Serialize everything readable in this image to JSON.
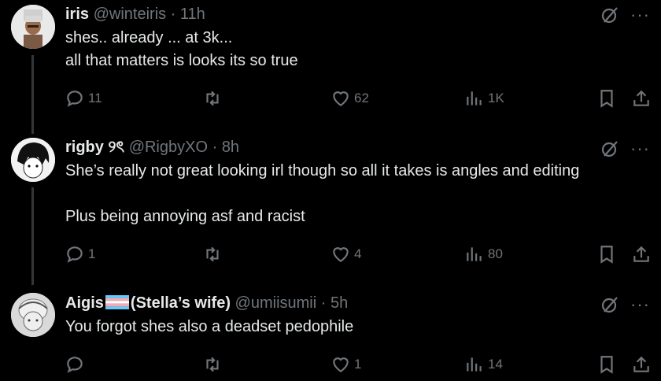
{
  "tweets": [
    {
      "name": "iris",
      "handle": "@winteiris",
      "time": "11h",
      "lines": [
        "shes.. already ... at 3k...",
        "all that matters is looks its so true"
      ],
      "replies": "11",
      "retweets": "",
      "likes": "62",
      "views": "1K"
    },
    {
      "name": "rigby",
      "name_suffix": "୨ৎ",
      "handle": "@RigbyXO",
      "time": "8h",
      "lines": [
        "She’s really not great looking irl though so all it takes is angles and editing",
        "",
        "Plus being annoying asf and racist"
      ],
      "replies": "1",
      "retweets": "",
      "likes": "4",
      "views": "80"
    },
    {
      "name": "Aigis",
      "name_suffix": "(Stella’s wife)",
      "handle": "@umiisumii",
      "time": "5h",
      "lines": [
        "You forgot shes also a deadset pedophile"
      ],
      "replies": "",
      "retweets": "",
      "likes": "1",
      "views": "14"
    }
  ],
  "colors": {
    "background": "#000000",
    "text": "#e7e9ea",
    "muted": "#71767b",
    "thread": "#333639"
  },
  "icons": [
    "reply-icon",
    "retweet-icon",
    "like-icon",
    "views-icon",
    "bookmark-icon",
    "share-icon",
    "grok-icon",
    "more-icon"
  ]
}
